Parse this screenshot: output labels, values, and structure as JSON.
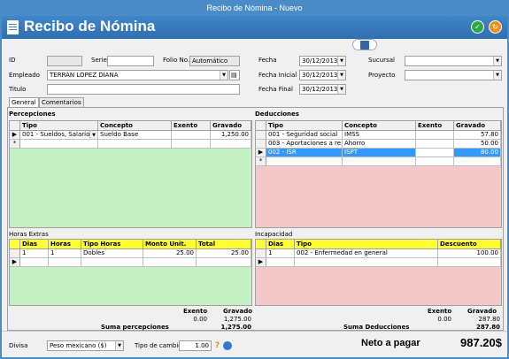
{
  "window_title": "Recibo de Nómina - Nuevo",
  "header": {
    "title": "Recibo de Nómina"
  },
  "form": {
    "id_label": "ID",
    "id_value": "",
    "serie_label": "Serie",
    "serie_value": "",
    "folio_label": "Folio No.",
    "folio_value": "Automático",
    "empleado_label": "Empleado",
    "empleado_value": "TERRAN LOPEZ DIANA",
    "titulo_label": "Titulo",
    "titulo_value": "",
    "fecha_label": "Fecha",
    "fecha_value": "30/12/2013",
    "fecha_inicial_label": "Fecha Inicial",
    "fecha_inicial_value": "30/12/2013",
    "fecha_final_label": "Fecha Final",
    "fecha_final_value": "30/12/2013",
    "sucursal_label": "Sucursal",
    "sucursal_value": "",
    "proyecto_label": "Proyecto",
    "proyecto_value": ""
  },
  "tabs": [
    {
      "label": "General"
    },
    {
      "label": "Comentarios"
    }
  ],
  "percepciones": {
    "title": "Percepciones",
    "headers": [
      "Tipo",
      "Concepto",
      "Exento",
      "Gravado"
    ],
    "rows": [
      {
        "tipo": "001 - Sueldos, Salarios",
        "concepto": "Sueldo Base",
        "exento": "",
        "gravado": "1,250.00"
      }
    ]
  },
  "deducciones": {
    "title": "Deducciones",
    "headers": [
      "Tipo",
      "Concepto",
      "Exento",
      "Gravado"
    ],
    "rows": [
      {
        "tipo": "001 - Seguridad social",
        "concepto": "IMSS",
        "exento": "",
        "gravado": "57.80"
      },
      {
        "tipo": "003 - Aportaciones a re...",
        "concepto": "Ahorro",
        "exento": "",
        "gravado": "50.00"
      },
      {
        "tipo": "002 - ISR",
        "concepto": "ISPT",
        "exento": "",
        "gravado": "80.00"
      }
    ]
  },
  "horas_extras": {
    "title": "Horas Extras",
    "headers": [
      "Dias",
      "Horas",
      "Tipo Horas",
      "Monto Unit.",
      "Total"
    ],
    "rows": [
      {
        "dias": "1",
        "horas": "1",
        "tipo": "Dobles",
        "monto": "25.00",
        "total": "25.00"
      }
    ]
  },
  "incapacidad": {
    "title": "Incapacidad",
    "headers": [
      "Dias",
      "Tipo",
      "Descuento"
    ],
    "rows": [
      {
        "dias": "1",
        "tipo": "002 - Enfermedad en general",
        "descuento": "100.00"
      }
    ]
  },
  "totals_perc": {
    "exento_label": "Exento",
    "gravado_label": "Gravado",
    "exento_value": "0.00",
    "gravado_value": "1,275.00",
    "suma_label": "Suma percepciones",
    "suma_value": "1,275.00"
  },
  "totals_ded": {
    "exento_label": "Exento",
    "gravado_label": "Gravado",
    "exento_value": "0.00",
    "gravado_value": "287.80",
    "suma_label": "Suma Deducciones",
    "suma_value": "287.80"
  },
  "footer": {
    "divisa_label": "Divisa",
    "divisa_value": "Peso mexicano ($)",
    "tipo_cambio_label": "Tipo de cambio",
    "tipo_cambio_value": "1.00",
    "neto_label": "Neto a pagar",
    "neto_value": "987.20$"
  },
  "icons": {
    "new_row": "*",
    "current_row": "▶",
    "dropdown": "▼",
    "ok": "✓",
    "refresh": "↻",
    "help": "?",
    "lookup": "▤"
  },
  "colors": {
    "percep_bg": "#c4f0c4",
    "deduc_bg": "#f4c8c8",
    "header_yellow": "#ffff33",
    "selection": "#3399ff",
    "titlebar": "#4a8cc7"
  }
}
